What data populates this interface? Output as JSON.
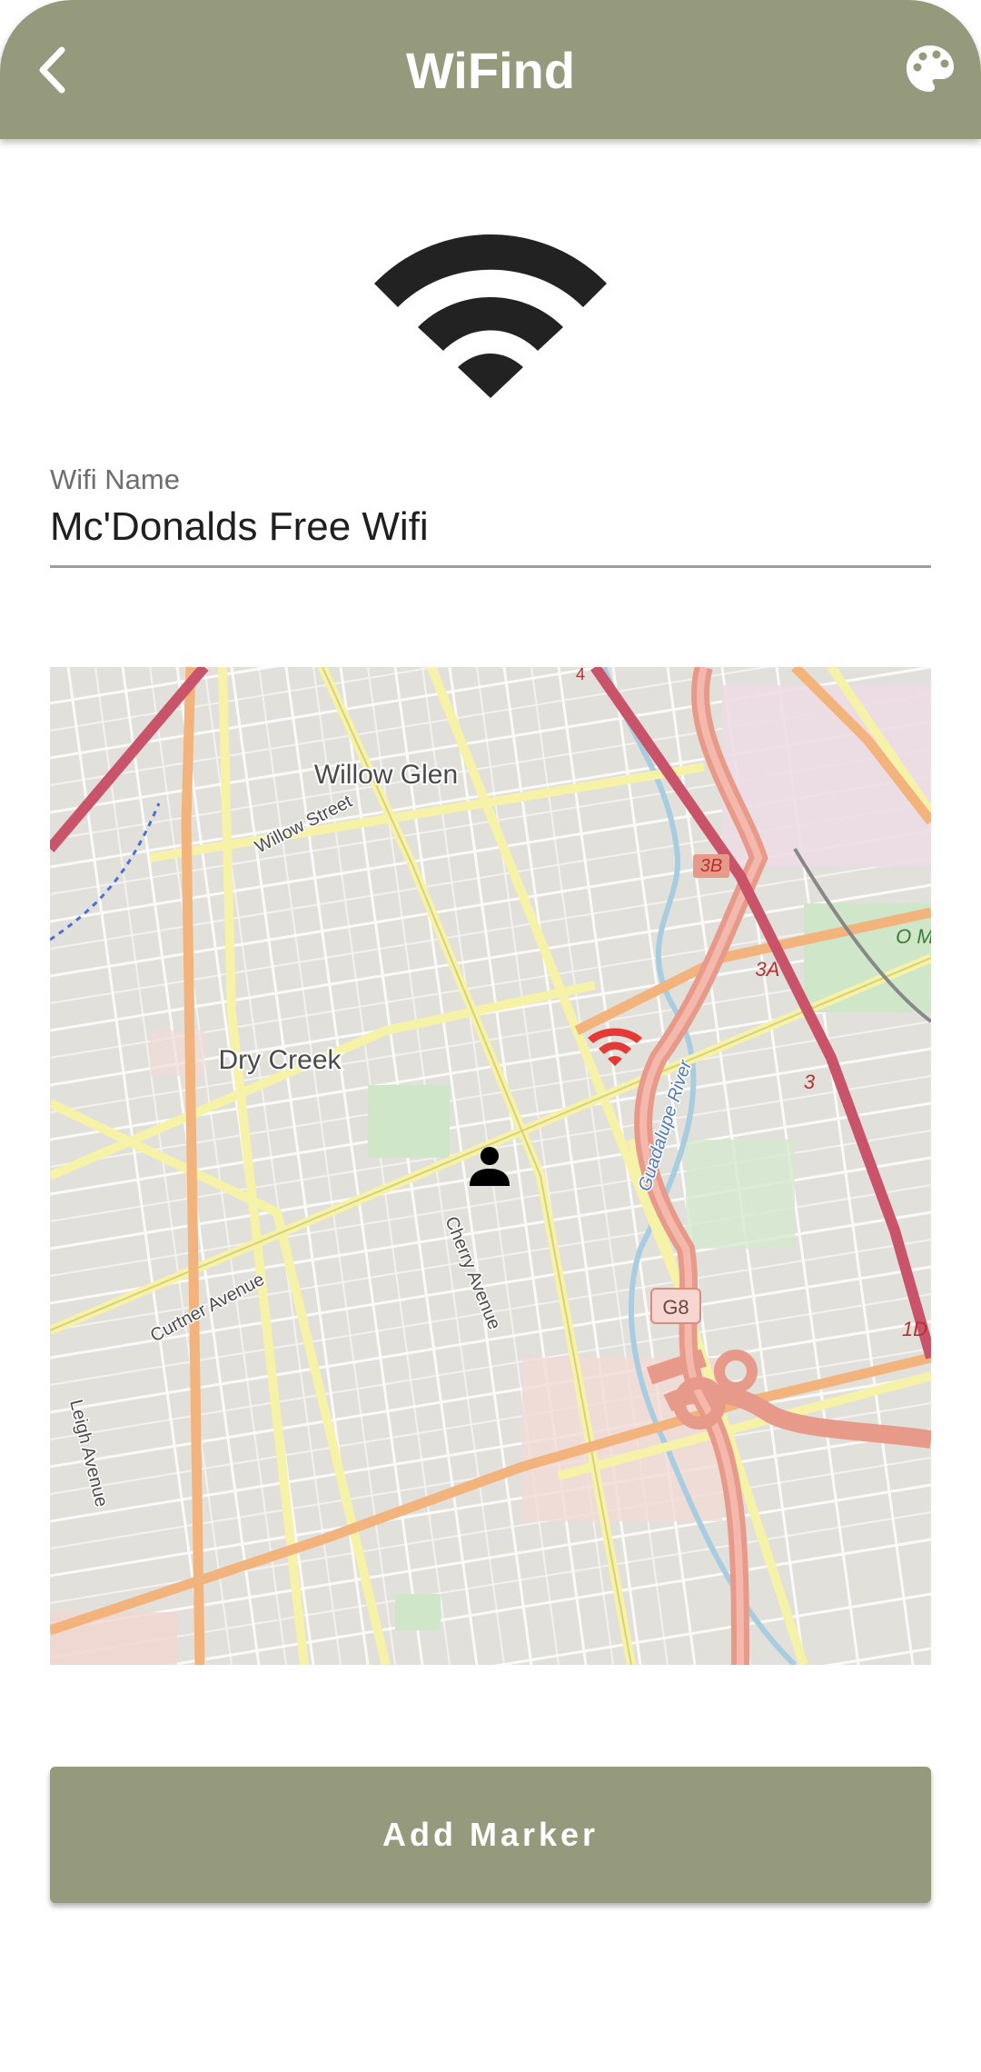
{
  "app": {
    "title": "WiFind"
  },
  "form": {
    "wifi_name_label": "Wifi Name",
    "wifi_name_value": "Mc'Donalds Free Wifi"
  },
  "map": {
    "labels": {
      "willow_glen": "Willow Glen",
      "willow_street": "Willow Street",
      "dry_creek": "Dry Creek",
      "curtner_avenue": "Curtner Avenue",
      "cherry_avenue": "Cherry Avenue",
      "leigh_avenue": "Leigh Avenue",
      "guadalupe_river": "Guadalupe River",
      "g8": "G8",
      "exit_3b": "3B",
      "exit_3a": "3A",
      "exit_3": "3",
      "exit_1d": "1D",
      "o_me": "O Me",
      "four": "4"
    }
  },
  "actions": {
    "add_marker_label": "Add Marker"
  },
  "colors": {
    "appbar": "#949a7b",
    "button": "#949a7b",
    "wifi_marker": "#e53935",
    "user_marker": "#000000"
  },
  "icons": {
    "back": "chevron-left",
    "palette": "palette",
    "hero": "wifi",
    "map_wifi_marker": "wifi",
    "map_user_marker": "person"
  }
}
